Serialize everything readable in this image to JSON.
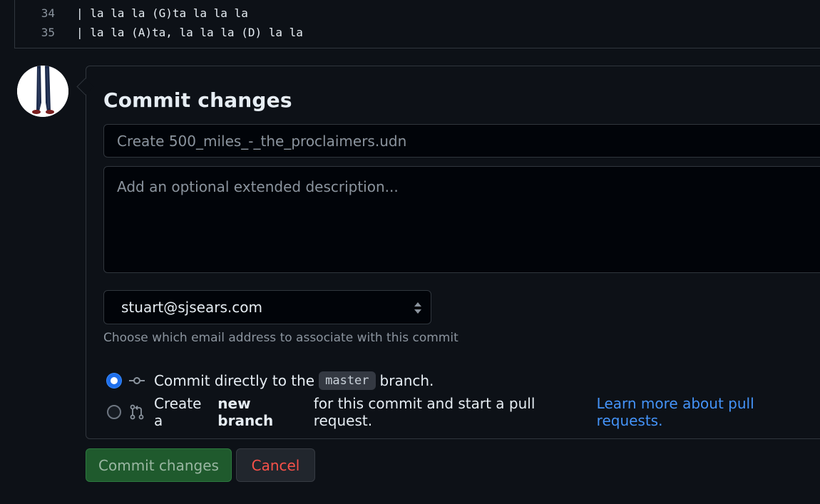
{
  "editor": {
    "lines": [
      {
        "number": "34",
        "text": "| la la la (G)ta la la la"
      },
      {
        "number": "35",
        "text": "| la la (A)ta, la la la (D) la la"
      }
    ]
  },
  "commit_form": {
    "title": "Commit changes",
    "summary_placeholder": "Create 500_miles_-_the_proclaimers.udn",
    "description_placeholder": "Add an optional extended description...",
    "email_selected": "stuart@sjsears.com",
    "email_hint": "Choose which email address to associate with this commit",
    "options": {
      "direct": {
        "prefix": "Commit directly to the",
        "branch": "master",
        "suffix": "branch.",
        "checked": true
      },
      "new_branch": {
        "prefix": "Create a",
        "bold": "new branch",
        "suffix": "for this commit and start a pull request.",
        "link": "Learn more about pull requests.",
        "checked": false
      }
    },
    "commit_button": "Commit changes",
    "cancel_button": "Cancel"
  },
  "icons": [
    "git-commit-icon",
    "git-pull-request-icon",
    "select-arrows-icon",
    "avatar"
  ],
  "colors": {
    "background": "#0d1117",
    "border": "#30363d",
    "accent_blue": "#4493f8",
    "commit_green": "#1f5a2d",
    "cancel_red": "#f85149"
  }
}
